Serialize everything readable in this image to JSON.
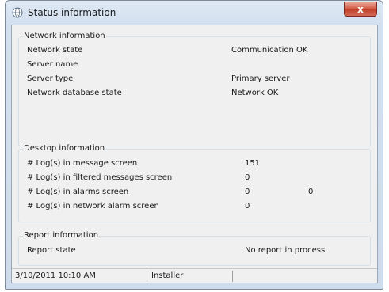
{
  "window": {
    "title": "Status information",
    "close_label": "x"
  },
  "network": {
    "title": "Network information",
    "rows": [
      {
        "label": "Network state",
        "value": "Communication OK"
      },
      {
        "label": "Server name",
        "value": ""
      },
      {
        "label": "Server type",
        "value": "Primary server"
      },
      {
        "label": "Network database state",
        "value": "Network OK"
      }
    ]
  },
  "desktop": {
    "title": "Desktop information",
    "rows": [
      {
        "label": "# Log(s) in message screen",
        "value": "151",
        "value2": ""
      },
      {
        "label": "# Log(s) in filtered messages screen",
        "value": "0",
        "value2": ""
      },
      {
        "label": "# Log(s) in alarms screen",
        "value": "0",
        "value2": "0"
      },
      {
        "label": "# Log(s) in network alarm screen",
        "value": "0",
        "value2": ""
      }
    ]
  },
  "report": {
    "title": "Report information",
    "rows": [
      {
        "label": "Report state",
        "value": "No report in process"
      }
    ]
  },
  "statusbar": {
    "datetime": "3/10/2011 10:10 AM",
    "user": "Installer"
  },
  "colors": {
    "close_button": "#c9452f",
    "client_bg": "#f0f0f0",
    "frame": "#d3e0ef"
  },
  "icons": {
    "app": "globe-icon",
    "close": "close-icon"
  }
}
